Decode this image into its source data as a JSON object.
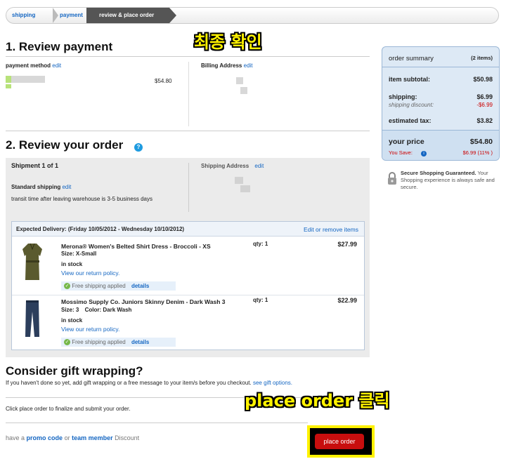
{
  "breadcrumb": {
    "step1": "shipping",
    "step2": "payment",
    "step3": "review & place order"
  },
  "annotations": {
    "confirm": "최종 확인",
    "click": "place order 클릭"
  },
  "payment": {
    "title": "1. Review payment",
    "method_label": "payment method",
    "edit": "edit",
    "amount": "$54.80",
    "billing_label": "Billing Address"
  },
  "order": {
    "title": "2. Review your order",
    "shipment": "Shipment 1 of 1",
    "method": "Standard shipping",
    "transit": "transit time after leaving warehouse is 3-5 business days",
    "shipping_address_label": "Shipping Address",
    "expected": "Expected Delivery: (Friday 10/05/2012 - Wednesday 10/10/2012)",
    "edit_remove": "Edit or remove items",
    "items": [
      {
        "name": "Merona® Women's Belted Shirt Dress - Broccoli - XS",
        "size": "Size: X-Small",
        "color": "",
        "stock": "in stock",
        "policy": "View our return policy.",
        "free": "Free shipping applied",
        "details": "details",
        "qty": "qty: 1",
        "price": "$27.99"
      },
      {
        "name": "Mossimo Supply Co. Juniors Skinny Denim - Dark Wash 3",
        "size": "Size: 3",
        "color": "Color: Dark Wash",
        "stock": "in stock",
        "policy": "View our return policy.",
        "free": "Free shipping applied",
        "details": "details",
        "qty": "qty: 1",
        "price": "$22.99"
      }
    ]
  },
  "gift": {
    "title": "Consider gift wrapping?",
    "text": "If you haven't done so yet, add gift wrapping or a free message to your item/s before you checkout.",
    "link": "see gift options."
  },
  "finalize": "Click place order to finalize and submit your order.",
  "promo": {
    "prefix": "have a",
    "promo": "promo code",
    "or": "or",
    "team": "team member",
    "suffix": "Discount"
  },
  "place_order": "place order",
  "summary": {
    "title": "order summary",
    "count": "(2 items)",
    "subtotal_label": "item subtotal:",
    "subtotal": "$50.98",
    "shipping_label": "shipping:",
    "shipping": "$6.99",
    "discount_label": "shipping discount:",
    "discount": "-$6.99",
    "tax_label": "estimated tax:",
    "tax": "$3.82",
    "price_label": "your price",
    "price": "$54.80",
    "save_label": "You Save:",
    "save": "$6.99 (11% )"
  },
  "secure": {
    "title": "Secure Shopping Guaranteed.",
    "text": "Your Shopping experience is always safe and secure."
  },
  "colors": {
    "link": "#1466c2",
    "button": "#c80e0e",
    "highlight": "#fff200",
    "panel": "#dde9f5"
  }
}
